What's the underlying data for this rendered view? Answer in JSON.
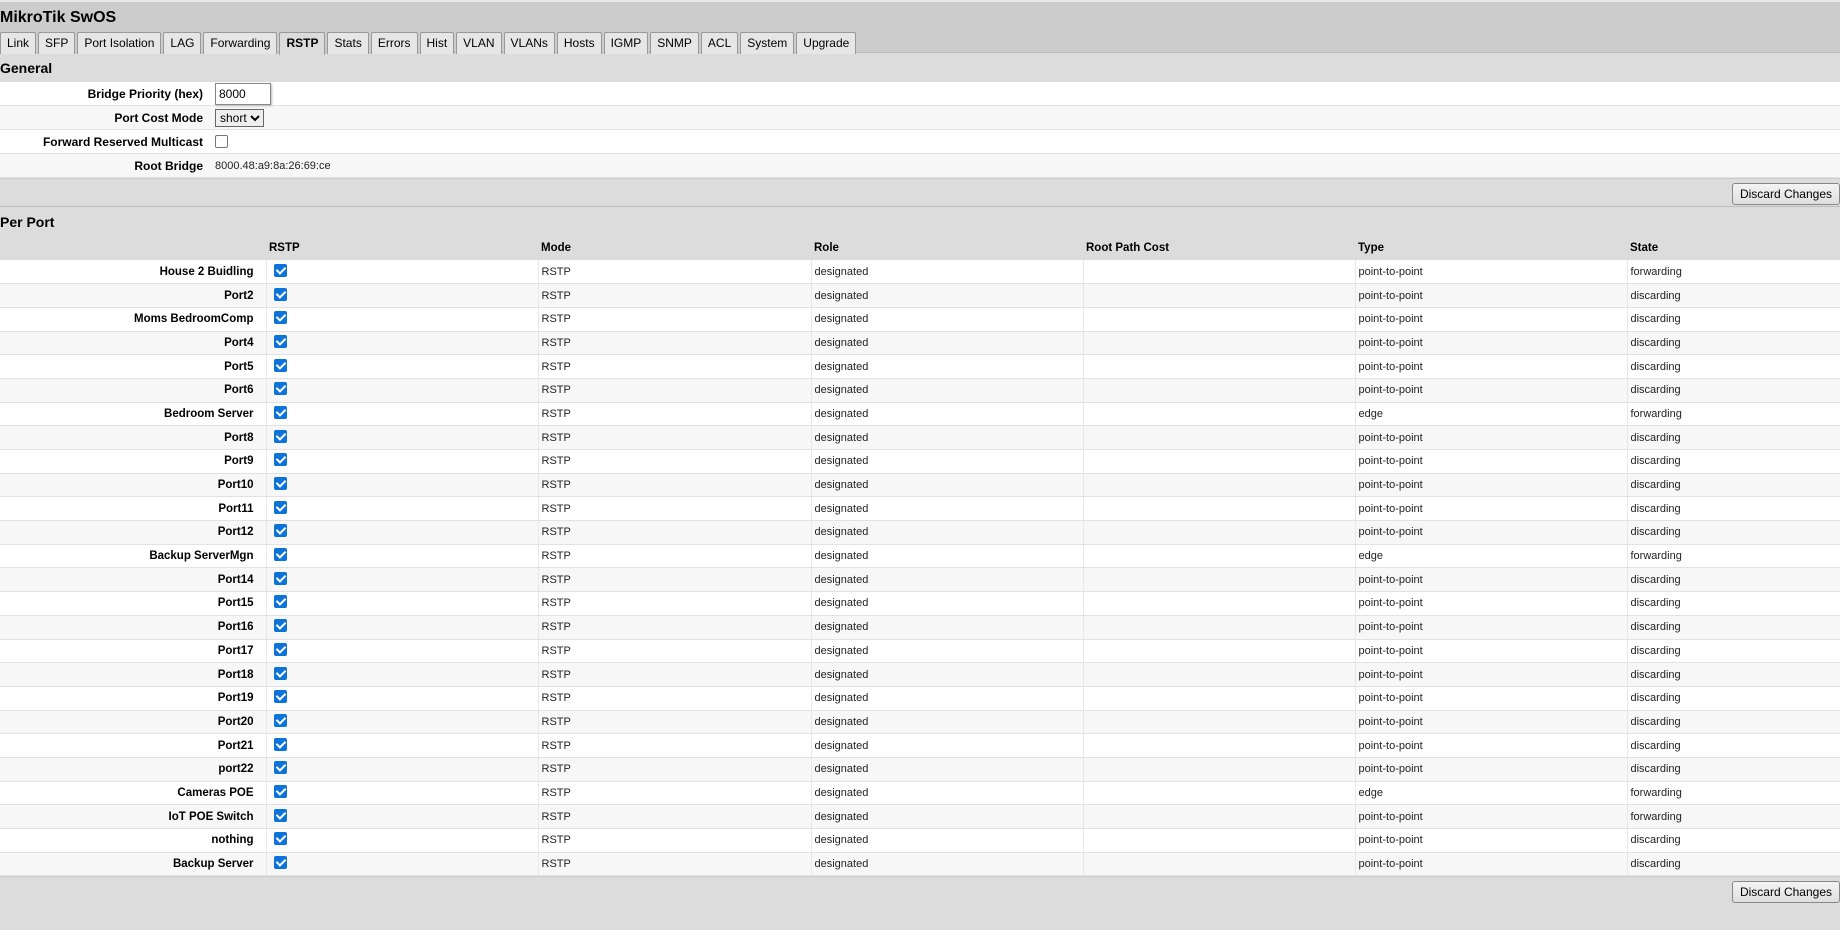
{
  "title": "MikroTik SwOS",
  "tabs": [
    "Link",
    "SFP",
    "Port Isolation",
    "LAG",
    "Forwarding",
    "RSTP",
    "Stats",
    "Errors",
    "Hist",
    "VLAN",
    "VLANs",
    "Hosts",
    "IGMP",
    "SNMP",
    "ACL",
    "System",
    "Upgrade"
  ],
  "active_tab": "RSTP",
  "general": {
    "heading": "General",
    "bridge_priority_label": "Bridge Priority (hex)",
    "bridge_priority": "8000",
    "port_cost_mode_label": "Port Cost Mode",
    "port_cost_mode": "short",
    "forward_reserved_label": "Forward Reserved Multicast",
    "forward_reserved": false,
    "root_bridge_label": "Root Bridge",
    "root_bridge": "8000.48:a9:8a:26:69:ce"
  },
  "discard_label": "Discard Changes",
  "per_port": {
    "heading": "Per Port",
    "columns": [
      "",
      "RSTP",
      "Mode",
      "Role",
      "Root Path Cost",
      "Type",
      "State"
    ],
    "rows": [
      {
        "name": "House 2 Buidling",
        "rstp": true,
        "mode": "RSTP",
        "role": "designated",
        "cost": "",
        "type": "point-to-point",
        "state": "forwarding"
      },
      {
        "name": "Port2",
        "rstp": true,
        "mode": "RSTP",
        "role": "designated",
        "cost": "",
        "type": "point-to-point",
        "state": "discarding"
      },
      {
        "name": "Moms BedroomComp",
        "rstp": true,
        "mode": "RSTP",
        "role": "designated",
        "cost": "",
        "type": "point-to-point",
        "state": "discarding"
      },
      {
        "name": "Port4",
        "rstp": true,
        "mode": "RSTP",
        "role": "designated",
        "cost": "",
        "type": "point-to-point",
        "state": "discarding"
      },
      {
        "name": "Port5",
        "rstp": true,
        "mode": "RSTP",
        "role": "designated",
        "cost": "",
        "type": "point-to-point",
        "state": "discarding"
      },
      {
        "name": "Port6",
        "rstp": true,
        "mode": "RSTP",
        "role": "designated",
        "cost": "",
        "type": "point-to-point",
        "state": "discarding"
      },
      {
        "name": "Bedroom Server",
        "rstp": true,
        "mode": "RSTP",
        "role": "designated",
        "cost": "",
        "type": "edge",
        "state": "forwarding"
      },
      {
        "name": "Port8",
        "rstp": true,
        "mode": "RSTP",
        "role": "designated",
        "cost": "",
        "type": "point-to-point",
        "state": "discarding"
      },
      {
        "name": "Port9",
        "rstp": true,
        "mode": "RSTP",
        "role": "designated",
        "cost": "",
        "type": "point-to-point",
        "state": "discarding"
      },
      {
        "name": "Port10",
        "rstp": true,
        "mode": "RSTP",
        "role": "designated",
        "cost": "",
        "type": "point-to-point",
        "state": "discarding"
      },
      {
        "name": "Port11",
        "rstp": true,
        "mode": "RSTP",
        "role": "designated",
        "cost": "",
        "type": "point-to-point",
        "state": "discarding"
      },
      {
        "name": "Port12",
        "rstp": true,
        "mode": "RSTP",
        "role": "designated",
        "cost": "",
        "type": "point-to-point",
        "state": "discarding"
      },
      {
        "name": "Backup ServerMgn",
        "rstp": true,
        "mode": "RSTP",
        "role": "designated",
        "cost": "",
        "type": "edge",
        "state": "forwarding"
      },
      {
        "name": "Port14",
        "rstp": true,
        "mode": "RSTP",
        "role": "designated",
        "cost": "",
        "type": "point-to-point",
        "state": "discarding"
      },
      {
        "name": "Port15",
        "rstp": true,
        "mode": "RSTP",
        "role": "designated",
        "cost": "",
        "type": "point-to-point",
        "state": "discarding"
      },
      {
        "name": "Port16",
        "rstp": true,
        "mode": "RSTP",
        "role": "designated",
        "cost": "",
        "type": "point-to-point",
        "state": "discarding"
      },
      {
        "name": "Port17",
        "rstp": true,
        "mode": "RSTP",
        "role": "designated",
        "cost": "",
        "type": "point-to-point",
        "state": "discarding"
      },
      {
        "name": "Port18",
        "rstp": true,
        "mode": "RSTP",
        "role": "designated",
        "cost": "",
        "type": "point-to-point",
        "state": "discarding"
      },
      {
        "name": "Port19",
        "rstp": true,
        "mode": "RSTP",
        "role": "designated",
        "cost": "",
        "type": "point-to-point",
        "state": "discarding"
      },
      {
        "name": "Port20",
        "rstp": true,
        "mode": "RSTP",
        "role": "designated",
        "cost": "",
        "type": "point-to-point",
        "state": "discarding"
      },
      {
        "name": "Port21",
        "rstp": true,
        "mode": "RSTP",
        "role": "designated",
        "cost": "",
        "type": "point-to-point",
        "state": "discarding"
      },
      {
        "name": "port22",
        "rstp": true,
        "mode": "RSTP",
        "role": "designated",
        "cost": "",
        "type": "point-to-point",
        "state": "discarding"
      },
      {
        "name": "Cameras POE",
        "rstp": true,
        "mode": "RSTP",
        "role": "designated",
        "cost": "",
        "type": "edge",
        "state": "forwarding"
      },
      {
        "name": "IoT POE Switch",
        "rstp": true,
        "mode": "RSTP",
        "role": "designated",
        "cost": "",
        "type": "point-to-point",
        "state": "forwarding"
      },
      {
        "name": "nothing",
        "rstp": true,
        "mode": "RSTP",
        "role": "designated",
        "cost": "",
        "type": "point-to-point",
        "state": "discarding"
      },
      {
        "name": "Backup Server",
        "rstp": true,
        "mode": "RSTP",
        "role": "designated",
        "cost": "",
        "type": "point-to-point",
        "state": "discarding"
      }
    ]
  }
}
